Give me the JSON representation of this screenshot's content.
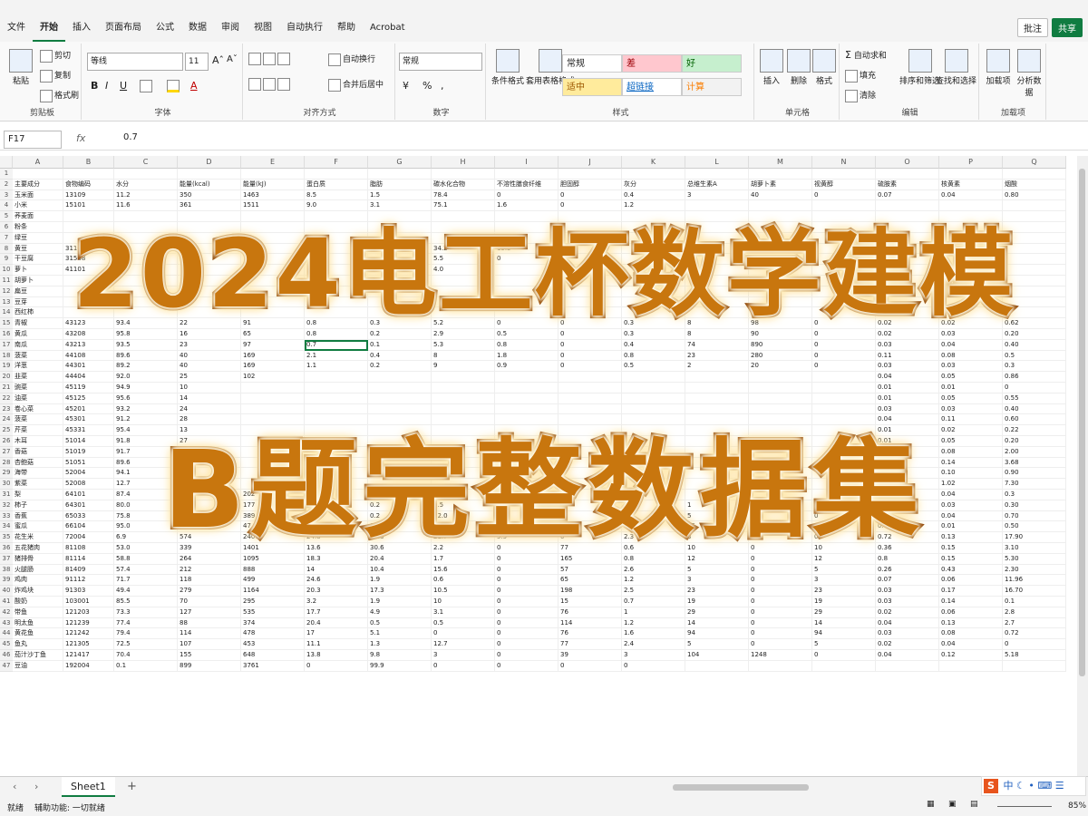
{
  "menu": [
    "文件",
    "开始",
    "插入",
    "页面布局",
    "公式",
    "数据",
    "审阅",
    "视图",
    "自动执行",
    "帮助",
    "Acrobat"
  ],
  "menu_active": "开始",
  "top_buttons": {
    "comment": "批注",
    "share": "共享"
  },
  "ribbon": {
    "clipboard": {
      "paste": "粘贴",
      "cut": "剪切",
      "copy": "复制",
      "format_painter": "格式刷",
      "label": "剪贴板"
    },
    "font": {
      "name": "等线",
      "size": "11",
      "label": "字体",
      "bold": "B",
      "italic": "I",
      "underline": "U"
    },
    "alignment": {
      "wrap": "自动换行",
      "merge": "合并后居中",
      "label": "对齐方式"
    },
    "number": {
      "format": "常规",
      "label": "数字"
    },
    "styles": {
      "cond": "条件格式",
      "table": "套用表格格式",
      "normal": "常规",
      "bad": "差",
      "good": "好",
      "neutral": "适中",
      "hyperlink": "超链接",
      "calc": "计算",
      "label": "样式"
    },
    "cells": {
      "insert": "插入",
      "delete": "删除",
      "format": "格式",
      "label": "单元格"
    },
    "editing": {
      "autosum": "自动求和",
      "fill": "填充",
      "clear": "清除",
      "sort": "排序和筛选",
      "find": "查找和选择",
      "label": "编辑"
    },
    "addins": {
      "addins": "加载项",
      "analyze": "分析数据",
      "label": "加载项"
    }
  },
  "formula_bar": {
    "cell_ref": "F17",
    "fx": "fx",
    "value": "0.7"
  },
  "columns": [
    "A",
    "B",
    "C",
    "D",
    "E",
    "F",
    "G",
    "H",
    "I",
    "J",
    "K",
    "L",
    "M",
    "N",
    "O",
    "P",
    "Q"
  ],
  "headers": [
    "主要成分",
    "食物编码",
    "水分",
    "能量(kcal)",
    "能量(kJ)",
    "蛋白质",
    "脂肪",
    "碳水化合物",
    "不溶性膳食纤维",
    "胆固醇",
    "灰分",
    "总维生素A",
    "胡萝卜素",
    "视黄醇",
    "硫胺素",
    "核黄素",
    "烟酸"
  ],
  "rows": [
    [
      "玉米面",
      "13109",
      "11.2",
      "350",
      "1463",
      "8.5",
      "1.5",
      "78.4",
      "0",
      "0",
      "0.4",
      "3",
      "40",
      "0",
      "0.07",
      "0.04",
      "0.80"
    ],
    [
      "小米",
      "15101",
      "11.6",
      "361",
      "1511",
      "9.0",
      "3.1",
      "75.1",
      "1.6",
      "0",
      "1.2",
      "",
      "",
      "",
      "",
      "",
      ""
    ],
    [
      "荞麦面",
      "",
      "",
      "",
      "",
      "",
      "",
      "",
      "",
      "",
      "",
      "",
      "",
      "",
      "",
      "",
      ""
    ],
    [
      "粉条",
      "",
      "",
      "",
      "",
      "",
      "",
      "",
      "",
      "",
      "",
      "",
      "",
      "",
      "",
      "",
      ""
    ],
    [
      "绿豆",
      "",
      "",
      "",
      "",
      "",
      "",
      "",
      "",
      "",
      "",
      "",
      "",
      "",
      "",
      "",
      ""
    ],
    [
      "黄豆",
      "31101",
      "",
      "",
      "",
      "",
      "",
      "34.2",
      "15.5",
      "",
      "",
      "",
      "",
      "",
      "",
      "",
      ""
    ],
    [
      "干豆腐",
      "31508",
      "",
      "",
      "",
      "",
      "",
      "5.5",
      "0",
      "",
      "",
      "",
      "",
      "",
      "",
      "",
      ""
    ],
    [
      "萝卜",
      "41101",
      "",
      "",
      "",
      "",
      "",
      "4.0",
      "",
      "",
      "",
      "",
      "",
      "",
      "",
      "",
      ""
    ],
    [
      "胡萝卜",
      "",
      "",
      "",
      "",
      "",
      "",
      "",
      "",
      "",
      "",
      "",
      "",
      "",
      "",
      "",
      ""
    ],
    [
      "扁豆",
      "",
      "",
      "",
      "",
      "",
      "",
      "",
      "",
      "",
      "",
      "",
      "",
      "",
      "",
      "",
      ""
    ],
    [
      "豆芽",
      "",
      "",
      "",
      "",
      "",
      "",
      "",
      "",
      "",
      "",
      "",
      "",
      "",
      "",
      "",
      ""
    ],
    [
      "西红柿",
      "",
      "",
      "",
      "",
      "",
      "",
      "",
      "",
      "",
      "",
      "",
      "",
      "",
      "",
      "",
      ""
    ],
    [
      "青椒",
      "43123",
      "93.4",
      "22",
      "91",
      "0.8",
      "0.3",
      "5.2",
      "0",
      "0",
      "0.3",
      "8",
      "98",
      "0",
      "0.02",
      "0.02",
      "0.62"
    ],
    [
      "黄瓜",
      "43208",
      "95.8",
      "16",
      "65",
      "0.8",
      "0.2",
      "2.9",
      "0.5",
      "0",
      "0.3",
      "8",
      "90",
      "0",
      "0.02",
      "0.03",
      "0.20"
    ],
    [
      "南瓜",
      "43213",
      "93.5",
      "23",
      "97",
      "0.7",
      "0.1",
      "5.3",
      "0.8",
      "0",
      "0.4",
      "74",
      "890",
      "0",
      "0.03",
      "0.04",
      "0.40"
    ],
    [
      "菠菜",
      "44108",
      "89.6",
      "40",
      "169",
      "2.1",
      "0.4",
      "8",
      "1.8",
      "0",
      "0.8",
      "23",
      "280",
      "0",
      "0.11",
      "0.08",
      "0.5"
    ],
    [
      "洋葱",
      "44301",
      "89.2",
      "40",
      "169",
      "1.1",
      "0.2",
      "9",
      "0.9",
      "0",
      "0.5",
      "2",
      "20",
      "0",
      "0.03",
      "0.03",
      "0.3"
    ],
    [
      "韭菜",
      "44404",
      "92.0",
      "25",
      "102",
      "",
      "",
      "",
      "",
      "",
      "",
      "",
      "",
      "",
      "0.04",
      "0.05",
      "0.86"
    ],
    [
      "豌菜",
      "45119",
      "94.9",
      "10",
      "",
      "",
      "",
      "",
      "",
      "",
      "",
      "",
      "",
      "",
      "0.01",
      "0.01",
      "0"
    ],
    [
      "油菜",
      "45125",
      "95.6",
      "14",
      "",
      "",
      "",
      "",
      "",
      "",
      "",
      "",
      "",
      "",
      "0.01",
      "0.05",
      "0.55"
    ],
    [
      "卷心菜",
      "45201",
      "93.2",
      "24",
      "",
      "",
      "",
      "",
      "",
      "",
      "",
      "",
      "",
      "",
      "0.03",
      "0.03",
      "0.40"
    ],
    [
      "菠菜",
      "45301",
      "91.2",
      "28",
      "",
      "",
      "",
      "",
      "",
      "",
      "",
      "",
      "",
      "",
      "0.04",
      "0.11",
      "0.60"
    ],
    [
      "芹菜",
      "45331",
      "95.4",
      "13",
      "",
      "",
      "",
      "",
      "",
      "",
      "",
      "",
      "",
      "",
      "0.01",
      "0.02",
      "0.22"
    ],
    [
      "木耳",
      "51014",
      "91.8",
      "27",
      "",
      "",
      "",
      "",
      "",
      "",
      "",
      "",
      "",
      "",
      "0.01",
      "0.05",
      "0.20"
    ],
    [
      "香菇",
      "51019",
      "91.7",
      "26",
      "",
      "",
      "",
      "",
      "",
      "",
      "",
      "",
      "",
      "",
      "",
      "0.08",
      "2.00"
    ],
    [
      "杏鲍菇",
      "51051",
      "89.6",
      "35",
      "",
      "",
      "",
      "",
      "",
      "",
      "",
      "",
      "",
      "",
      "0.03",
      "0.14",
      "3.68"
    ],
    [
      "海带",
      "52004",
      "94.1",
      "16",
      "",
      "",
      "",
      "",
      "",
      "",
      "",
      "",
      "",
      "",
      "0.02",
      "0.10",
      "0.90"
    ],
    [
      "紫菜",
      "52008",
      "12.7",
      "250",
      "",
      "",
      "",
      "",
      "",
      "",
      "",
      "",
      "",
      "",
      "0.27",
      "1.02",
      "7.30"
    ],
    [
      "梨",
      "64101",
      "87.4",
      "49",
      "202",
      "0.2",
      "0.2",
      "11.1",
      "0.6",
      "0",
      "",
      "",
      "",
      "",
      "0.05",
      "0.04",
      "0.3"
    ],
    [
      "柿子",
      "64301",
      "80.0",
      "42",
      "177",
      "0.8",
      "0.2",
      "9.5",
      "0.4",
      "0",
      "0.5",
      "1",
      "10",
      "0",
      "0",
      "0.03",
      "0.30"
    ],
    [
      "香蕉",
      "65033",
      "75.8",
      "93",
      "389",
      "1.4",
      "0.2",
      "22.0",
      "1.2",
      "0",
      "0.6",
      "5",
      "60",
      "0",
      "0.02",
      "0.04",
      "0.70"
    ],
    [
      "蜜瓜",
      "66104",
      "95.0",
      "11",
      "47",
      "0.4",
      "0",
      "4.0",
      "3.2",
      "0",
      "0.6",
      "15",
      "180",
      "0",
      "0.02",
      "0.01",
      "0.50"
    ],
    [
      "花生米",
      "72004",
      "6.9",
      "574",
      "2400",
      "24.8",
      "44.3",
      "21.7",
      "5.5",
      "0",
      "2.3",
      "3",
      "30",
      "0",
      "0.72",
      "0.13",
      "17.90"
    ],
    [
      "五花猪肉",
      "81108",
      "53.0",
      "339",
      "1401",
      "13.6",
      "30.6",
      "2.2",
      "0",
      "77",
      "0.6",
      "10",
      "0",
      "10",
      "0.36",
      "0.15",
      "3.10"
    ],
    [
      "猪排骨",
      "81114",
      "58.8",
      "264",
      "1095",
      "18.3",
      "20.4",
      "1.7",
      "0",
      "165",
      "0.8",
      "12",
      "0",
      "12",
      "0.8",
      "0.15",
      "5.30"
    ],
    [
      "火腿肠",
      "81409",
      "57.4",
      "212",
      "888",
      "14",
      "10.4",
      "15.6",
      "0",
      "57",
      "2.6",
      "5",
      "0",
      "5",
      "0.26",
      "0.43",
      "2.30"
    ],
    [
      "鸡肉",
      "91112",
      "71.7",
      "118",
      "499",
      "24.6",
      "1.9",
      "0.6",
      "0",
      "65",
      "1.2",
      "3",
      "0",
      "3",
      "0.07",
      "0.06",
      "11.96"
    ],
    [
      "炸鸡块",
      "91303",
      "49.4",
      "279",
      "1164",
      "20.3",
      "17.3",
      "10.5",
      "0",
      "198",
      "2.5",
      "23",
      "0",
      "23",
      "0.03",
      "0.17",
      "16.70"
    ],
    [
      "酸奶",
      "103001",
      "85.5",
      "70",
      "295",
      "3.2",
      "1.9",
      "10",
      "0",
      "15",
      "0.7",
      "19",
      "0",
      "19",
      "0.03",
      "0.14",
      "0.1"
    ],
    [
      "带鱼",
      "121203",
      "73.3",
      "127",
      "535",
      "17.7",
      "4.9",
      "3.1",
      "0",
      "76",
      "1",
      "29",
      "0",
      "29",
      "0.02",
      "0.06",
      "2.8"
    ],
    [
      "明太鱼",
      "121239",
      "77.4",
      "88",
      "374",
      "20.4",
      "0.5",
      "0.5",
      "0",
      "114",
      "1.2",
      "14",
      "0",
      "14",
      "0.04",
      "0.13",
      "2.7"
    ],
    [
      "黄花鱼",
      "121242",
      "79.4",
      "114",
      "478",
      "17",
      "5.1",
      "0",
      "0",
      "76",
      "1.6",
      "94",
      "0",
      "94",
      "0.03",
      "0.08",
      "0.72"
    ],
    [
      "鱼丸",
      "121305",
      "72.5",
      "107",
      "453",
      "11.1",
      "1.3",
      "12.7",
      "0",
      "77",
      "2.4",
      "5",
      "0",
      "5",
      "0.02",
      "0.04",
      "0"
    ],
    [
      "茄汁沙丁鱼",
      "121417",
      "70.4",
      "155",
      "648",
      "13.8",
      "9.8",
      "3",
      "0",
      "39",
      "3",
      "104",
      "1248",
      "0",
      "0.04",
      "0.12",
      "5.18"
    ],
    [
      "豆油",
      "192004",
      "0.1",
      "899",
      "3761",
      "0",
      "99.9",
      "0",
      "0",
      "0",
      "0",
      "",
      "",
      "",
      "",
      "",
      ""
    ]
  ],
  "sheet": {
    "name": "Sheet1",
    "add": "+"
  },
  "status": {
    "ready": "就绪",
    "accessibility": "辅助功能: 一切就绪",
    "zoom": "85%"
  },
  "overlay": {
    "line1": "2024电工杯数学建模",
    "line2": "B题完整数据集"
  }
}
